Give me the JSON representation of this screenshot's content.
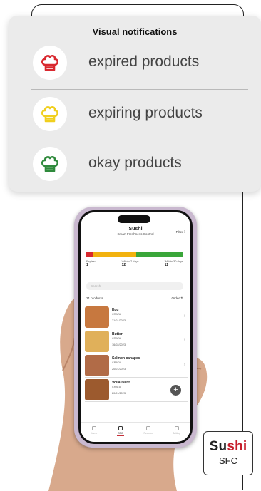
{
  "notifications": {
    "title": "Visual notifications",
    "items": [
      {
        "label": "expired products",
        "color": "#d9282f",
        "icon": "chef-hat-icon"
      },
      {
        "label": "expiring products",
        "color": "#f0cf1e",
        "icon": "chef-hat-icon"
      },
      {
        "label": "okay products",
        "color": "#2f8a3c",
        "icon": "chef-hat-icon"
      }
    ]
  },
  "app": {
    "brand": "Sushi",
    "subtitle": "Smart Freshness Control",
    "filter_label": "Filter",
    "status_colors": {
      "expired": "#d8292f",
      "expiring": "#f2b20f",
      "okay": "#3aa63a"
    },
    "legend": [
      {
        "label": "Expired",
        "count": "1"
      },
      {
        "label": "Within 7 days",
        "count": "12"
      },
      {
        "label": "Within 30 days",
        "count": "11"
      }
    ],
    "search_placeholder": "Search",
    "product_count": "21 products",
    "order_label": "Order",
    "products": [
      {
        "name": "Egg",
        "tag": "CRATA",
        "date": "21/01/2023"
      },
      {
        "name": "Butter",
        "tag": "CRATA",
        "date": "16/02/2023"
      },
      {
        "name": "Salmon canapes",
        "tag": "CRATA",
        "date": "20/01/2023"
      },
      {
        "name": "Vollauvent",
        "tag": "CRATA",
        "date": "20/01/2023"
      }
    ],
    "nav": [
      {
        "label": "Home",
        "active": false
      },
      {
        "label": "SFC",
        "active": true
      },
      {
        "label": "Reorder",
        "active": false
      },
      {
        "label": "Setting",
        "active": false
      }
    ]
  },
  "logo": {
    "part1": "Su",
    "part2": "shi",
    "sub": "SFC",
    "accent": "#c61d2b"
  }
}
